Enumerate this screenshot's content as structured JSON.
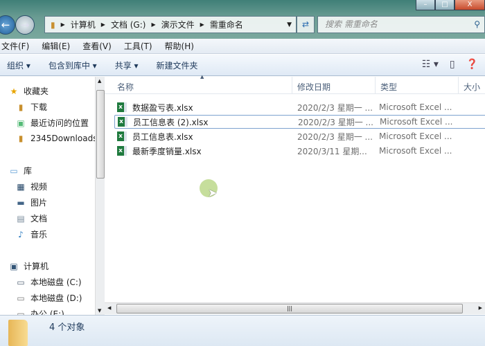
{
  "window": {
    "minimize": "–",
    "maximize": "□",
    "close": "X"
  },
  "address": {
    "segments": [
      "计算机",
      "文档 (G:)",
      "演示文件",
      "需重命名"
    ]
  },
  "search": {
    "placeholder": "搜索 需重命名"
  },
  "menu": [
    "文件(F)",
    "编辑(E)",
    "查看(V)",
    "工具(T)",
    "帮助(H)"
  ],
  "toolbar": {
    "organize": "组织 ▾",
    "include": "包含到库中 ▾",
    "share": "共享 ▾",
    "new_folder": "新建文件夹"
  },
  "sidebar": {
    "favorites": {
      "label": "收藏夹",
      "items": [
        "下载",
        "最近访问的位置",
        "2345Downloads"
      ]
    },
    "libraries": {
      "label": "库",
      "items": [
        "视频",
        "图片",
        "文档",
        "音乐"
      ]
    },
    "computer": {
      "label": "计算机",
      "items": [
        "本地磁盘 (C:)",
        "本地磁盘 (D:)",
        "办公 (E:)"
      ]
    }
  },
  "columns": [
    "名称",
    "修改日期",
    "类型",
    "大小"
  ],
  "files": [
    {
      "name": "数据盈亏表.xlsx",
      "date": "2020/2/3 星期一 ...",
      "type": "Microsoft Excel ..."
    },
    {
      "name": "员工信息表 (2).xlsx",
      "date": "2020/2/3 星期一 ...",
      "type": "Microsoft Excel ...",
      "selected": true
    },
    {
      "name": "员工信息表.xlsx",
      "date": "2020/2/3 星期一 ...",
      "type": "Microsoft Excel ..."
    },
    {
      "name": "最新季度销量.xlsx",
      "date": "2020/3/11 星期...",
      "type": "Microsoft Excel ..."
    }
  ],
  "status": {
    "count": "4 个对象"
  }
}
